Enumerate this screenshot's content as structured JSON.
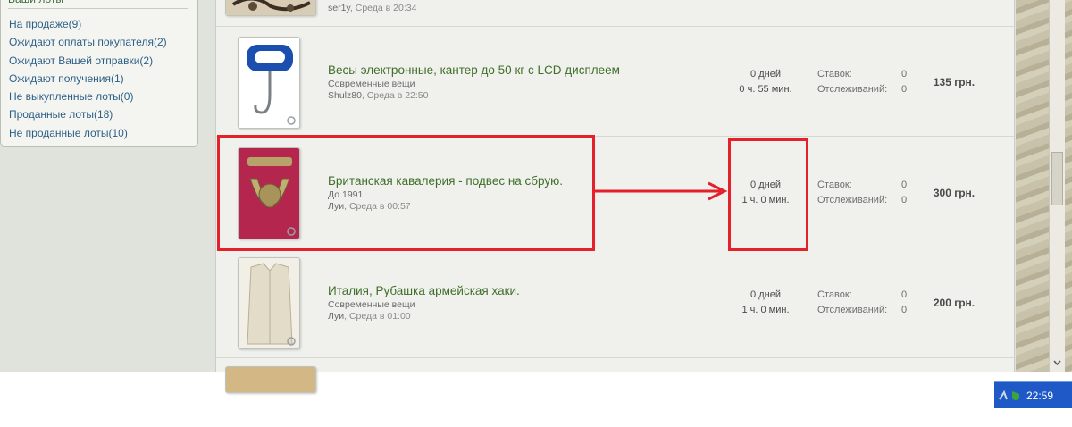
{
  "sidebar": {
    "title": "Ваши лоты",
    "items": [
      {
        "label": "На продаже",
        "count": "(9)"
      },
      {
        "label": "Ожидают оплаты покупателя",
        "count": "(2)"
      },
      {
        "label": "Ожидают Вашей отправки",
        "count": "(2)"
      },
      {
        "label": "Ожидают получения",
        "count": "(1)"
      },
      {
        "label": "Не выкупленные лоты",
        "count": "(0)"
      },
      {
        "label": "Проданные лоты",
        "count": "(18)"
      },
      {
        "label": "Не проданные лоты",
        "count": "(10)"
      }
    ]
  },
  "lots": [
    {
      "seller": "ser1y",
      "when": ", Среда в 20:34"
    },
    {
      "title": "Весы электронные, кантер до 50 кг с LCD дисплеем",
      "category": "Современные вещи",
      "seller": "Shulz80",
      "when": ", Среда в 22:50",
      "days": "0 дней",
      "time": "0 ч. 55 мин.",
      "bids_label": "Ставок:",
      "bids": "0",
      "watch_label": "Отслеживаний:",
      "watch": "0",
      "price": "135 грн."
    },
    {
      "title": "Британская кавалерия - подвес на сбрую.",
      "category": "До 1991",
      "seller": "Луи",
      "when": ", Среда в 00:57",
      "days": "0 дней",
      "time": "1 ч. 0 мин.",
      "bids_label": "Ставок:",
      "bids": "0",
      "watch_label": "Отслеживаний:",
      "watch": "0",
      "price": "300 грн."
    },
    {
      "title": "Италия, Рубашка армейская хаки.",
      "category": "Современные вещи",
      "seller": "Луи",
      "when": ", Среда в 01:00",
      "days": "0 дней",
      "time": "1 ч. 0 мин.",
      "bids_label": "Ставок:",
      "bids": "0",
      "watch_label": "Отслеживаний:",
      "watch": "0",
      "price": "200 грн."
    }
  ],
  "taskbar": {
    "clock": "22:59"
  },
  "colors": {
    "annotation": "#e4202a",
    "link": "#2c5f86",
    "title": "#3f6f2a",
    "taskbar": "#1f58c7"
  },
  "icons": [
    "magnifier-icon",
    "tray-network-icon",
    "tray-shield-icon"
  ]
}
